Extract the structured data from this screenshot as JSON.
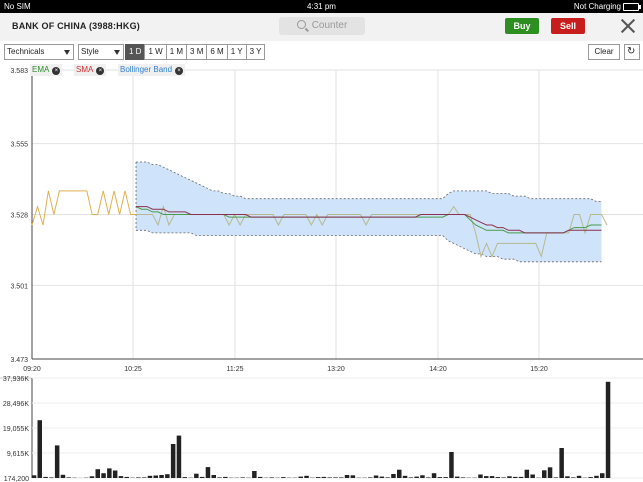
{
  "status": {
    "carrier": "No SIM",
    "time": "4:31 pm",
    "battery": "Not Charging"
  },
  "header": {
    "title": "BANK OF CHINA (3988:HKG)",
    "search_placeholder": "Counter",
    "buy_label": "Buy",
    "sell_label": "Sell"
  },
  "toolbar": {
    "technicals_label": "Technicals",
    "style_label": "Style",
    "ranges": [
      "1 D",
      "1 W",
      "1 M",
      "3 M",
      "6 M",
      "1 Y",
      "3 Y"
    ],
    "active_range": "1 D",
    "clear_label": "Clear"
  },
  "legend": [
    {
      "label": "EMA",
      "color": "#2e8b2e"
    },
    {
      "label": "SMA",
      "color": "#d03030"
    },
    {
      "label": "Bollinger Band",
      "color": "#2f7fd0"
    }
  ],
  "colors": {
    "price": "#e0b050",
    "ema": "#4a9a4a",
    "sma": "#8a3050",
    "band_fill": "#cfe4fb",
    "volume": "#222222"
  },
  "chart_data": {
    "type": "line",
    "x_ticks": [
      "09:20",
      "10:25",
      "11:25",
      "13:20",
      "14:20",
      "15:20"
    ],
    "y_ticks": [
      3.583,
      3.555,
      3.528,
      3.501,
      3.473
    ],
    "ylim": [
      3.473,
      3.583
    ],
    "price": [
      3.524,
      3.531,
      3.524,
      3.537,
      3.528,
      3.537,
      3.537,
      3.537,
      3.537,
      3.537,
      3.537,
      3.528,
      3.528,
      3.537,
      3.528,
      3.537,
      3.528,
      3.537,
      3.528,
      3.528,
      3.528,
      3.528,
      3.528,
      3.524,
      3.531,
      3.524,
      3.528,
      3.528,
      3.528,
      3.528,
      3.528,
      3.528,
      3.528,
      3.528,
      3.528,
      3.528,
      3.524,
      3.528,
      3.524,
      3.528,
      3.528,
      3.528,
      3.528,
      3.528,
      3.528,
      3.524,
      3.528,
      3.528,
      3.528,
      3.528,
      3.528,
      3.524,
      3.528,
      3.524,
      3.528,
      3.528,
      3.528,
      3.528,
      3.528,
      3.528,
      3.528,
      3.524,
      3.528,
      3.528,
      3.528,
      3.528,
      3.528,
      3.528,
      3.528,
      3.528,
      3.528,
      3.528,
      3.528,
      3.528,
      3.528,
      3.528,
      3.528,
      3.531,
      3.528,
      3.528,
      3.528,
      3.521,
      3.512,
      3.517,
      3.512,
      3.517,
      3.517,
      3.517,
      3.517,
      3.517,
      3.517,
      3.517,
      3.517,
      3.512,
      3.521,
      3.521,
      3.521,
      3.521,
      3.521,
      3.528,
      3.528,
      3.521,
      3.528,
      3.528,
      3.528,
      3.524
    ],
    "ema": [
      null,
      null,
      null,
      null,
      null,
      null,
      null,
      null,
      null,
      null,
      null,
      null,
      null,
      null,
      null,
      null,
      null,
      null,
      null,
      3.531,
      3.53,
      3.53,
      3.529,
      3.529,
      3.528,
      3.528,
      3.528,
      3.528,
      3.528,
      3.528,
      3.528,
      3.528,
      3.528,
      3.528,
      3.528,
      3.528,
      3.527,
      3.527,
      3.527,
      3.527,
      3.527,
      3.527,
      3.527,
      3.527,
      3.527,
      3.527,
      3.527,
      3.527,
      3.527,
      3.527,
      3.527,
      3.527,
      3.527,
      3.527,
      3.527,
      3.527,
      3.527,
      3.527,
      3.527,
      3.527,
      3.527,
      3.527,
      3.527,
      3.527,
      3.527,
      3.527,
      3.527,
      3.527,
      3.527,
      3.527,
      3.527,
      3.527,
      3.527,
      3.527,
      3.527,
      3.527,
      3.528,
      3.528,
      3.528,
      3.528,
      3.526,
      3.524,
      3.523,
      3.522,
      3.522,
      3.522,
      3.522,
      3.521,
      3.521,
      3.521,
      3.521,
      3.521,
      3.521,
      3.521,
      3.521,
      3.521,
      3.521,
      3.521,
      3.522,
      3.523,
      3.523,
      3.523,
      3.524,
      3.524,
      3.524
    ],
    "sma": [
      null,
      null,
      null,
      null,
      null,
      null,
      null,
      null,
      null,
      null,
      null,
      null,
      null,
      null,
      null,
      null,
      null,
      null,
      null,
      3.531,
      3.531,
      3.531,
      3.53,
      3.53,
      3.53,
      3.529,
      3.529,
      3.529,
      3.529,
      3.528,
      3.528,
      3.528,
      3.528,
      3.528,
      3.528,
      3.528,
      3.528,
      3.528,
      3.528,
      3.528,
      3.527,
      3.527,
      3.527,
      3.527,
      3.527,
      3.527,
      3.527,
      3.527,
      3.527,
      3.527,
      3.527,
      3.527,
      3.527,
      3.527,
      3.527,
      3.527,
      3.527,
      3.527,
      3.527,
      3.527,
      3.527,
      3.527,
      3.527,
      3.527,
      3.527,
      3.527,
      3.527,
      3.527,
      3.527,
      3.527,
      3.527,
      3.528,
      3.528,
      3.528,
      3.528,
      3.528,
      3.528,
      3.528,
      3.528,
      3.528,
      3.527,
      3.526,
      3.525,
      3.524,
      3.524,
      3.523,
      3.523,
      3.522,
      3.522,
      3.522,
      3.521,
      3.521,
      3.521,
      3.521,
      3.521,
      3.521,
      3.521,
      3.521,
      3.522,
      3.522,
      3.522,
      3.522,
      3.522,
      3.522,
      3.522
    ],
    "band_upper": [
      null,
      null,
      null,
      null,
      null,
      null,
      null,
      null,
      null,
      null,
      null,
      null,
      null,
      null,
      null,
      null,
      null,
      null,
      null,
      3.548,
      3.548,
      3.548,
      3.547,
      3.547,
      3.546,
      3.545,
      3.544,
      3.543,
      3.542,
      3.541,
      3.54,
      3.539,
      3.538,
      3.537,
      3.537,
      3.536,
      3.536,
      3.535,
      3.535,
      3.534,
      3.534,
      3.534,
      3.534,
      3.534,
      3.534,
      3.534,
      3.534,
      3.534,
      3.534,
      3.534,
      3.534,
      3.534,
      3.534,
      3.534,
      3.534,
      3.534,
      3.534,
      3.534,
      3.534,
      3.534,
      3.534,
      3.534,
      3.534,
      3.534,
      3.534,
      3.534,
      3.534,
      3.534,
      3.534,
      3.534,
      3.534,
      3.534,
      3.534,
      3.534,
      3.534,
      3.534,
      3.536,
      3.537,
      3.537,
      3.537,
      3.537,
      3.537,
      3.537,
      3.537,
      3.536,
      3.536,
      3.536,
      3.536,
      3.535,
      3.535,
      3.535,
      3.534,
      3.534,
      3.534,
      3.534,
      3.534,
      3.534,
      3.534,
      3.534,
      3.534,
      3.534,
      3.534,
      3.534,
      3.533,
      3.533
    ],
    "band_lower": [
      null,
      null,
      null,
      null,
      null,
      null,
      null,
      null,
      null,
      null,
      null,
      null,
      null,
      null,
      null,
      null,
      null,
      null,
      null,
      3.522,
      3.522,
      3.522,
      3.521,
      3.521,
      3.521,
      3.521,
      3.521,
      3.521,
      3.521,
      3.521,
      3.52,
      3.52,
      3.52,
      3.52,
      3.52,
      3.52,
      3.52,
      3.52,
      3.52,
      3.52,
      3.52,
      3.52,
      3.52,
      3.52,
      3.52,
      3.52,
      3.52,
      3.52,
      3.52,
      3.52,
      3.52,
      3.52,
      3.52,
      3.52,
      3.52,
      3.52,
      3.52,
      3.52,
      3.52,
      3.52,
      3.52,
      3.52,
      3.52,
      3.52,
      3.52,
      3.52,
      3.52,
      3.52,
      3.52,
      3.52,
      3.52,
      3.52,
      3.52,
      3.52,
      3.52,
      3.52,
      3.518,
      3.517,
      3.516,
      3.515,
      3.514,
      3.513,
      3.513,
      3.512,
      3.512,
      3.512,
      3.511,
      3.511,
      3.511,
      3.51,
      3.51,
      3.51,
      3.51,
      3.51,
      3.51,
      3.51,
      3.51,
      3.51,
      3.51,
      3.51,
      3.51,
      3.51,
      3.51,
      3.51,
      3.51
    ],
    "volume_ticks": [
      "37,936K",
      "28,496K",
      "19,055K",
      "9,615K",
      "174,200"
    ],
    "volume_ylim": [
      174.2,
      37936
    ],
    "volume": [
      1200,
      22000,
      600,
      400,
      12500,
      1400,
      400,
      300,
      200,
      300,
      800,
      3500,
      2000,
      3800,
      3000,
      900,
      600,
      300,
      400,
      400,
      1000,
      1100,
      1300,
      1600,
      13000,
      16200,
      500,
      300,
      1800,
      600,
      4300,
      1300,
      400,
      600,
      300,
      300,
      400,
      300,
      2800,
      600,
      300,
      400,
      300,
      500,
      300,
      300,
      700,
      1000,
      300,
      500,
      600,
      400,
      400,
      400,
      1300,
      1200,
      300,
      300,
      400,
      1100,
      700,
      400,
      1700,
      3300,
      1000,
      400,
      700,
      1200,
      400,
      2000,
      500,
      500,
      10000,
      700,
      400,
      300,
      300,
      1500,
      900,
      900,
      500,
      400,
      800,
      600,
      600,
      3300,
      1500,
      300,
      3100,
      4200,
      400,
      11500,
      800,
      400,
      1000,
      300,
      500,
      1000,
      2000,
      36500
    ]
  }
}
